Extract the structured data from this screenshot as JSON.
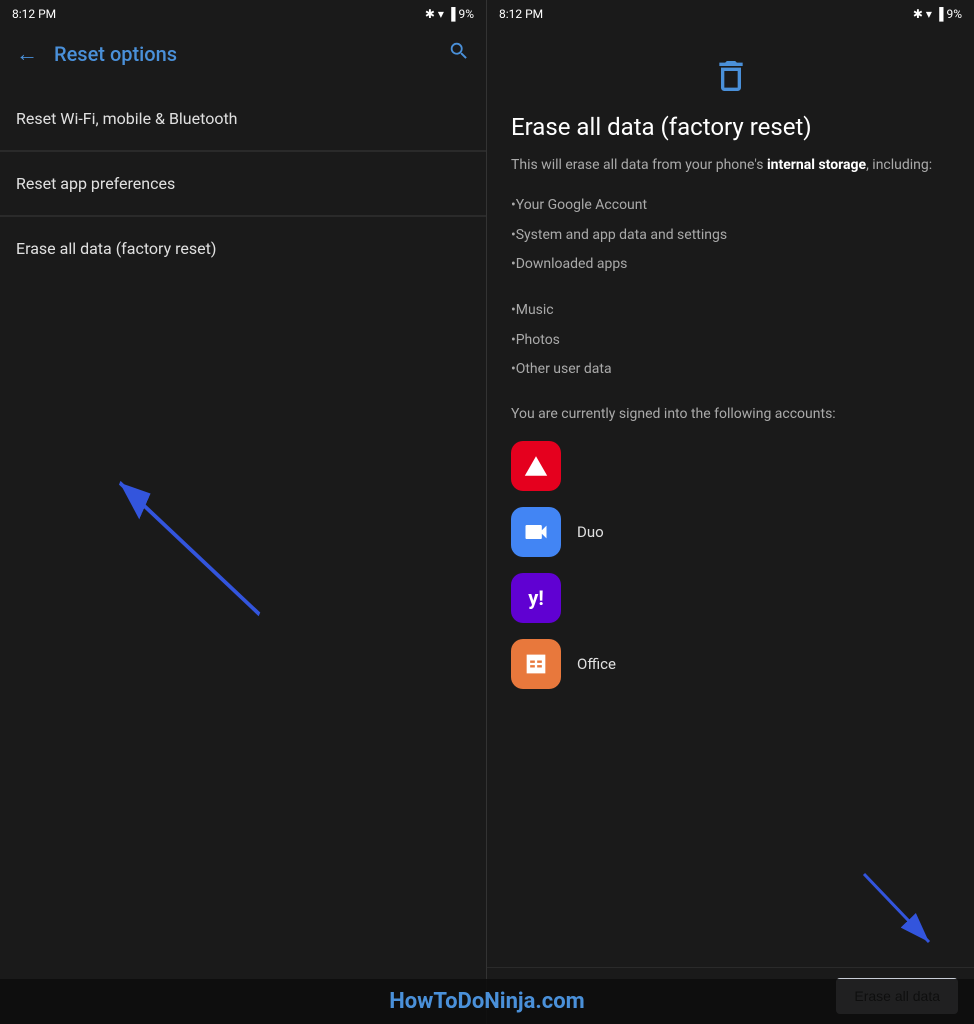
{
  "leftPanel": {
    "statusBar": {
      "time": "8:12 PM",
      "battery": "9%"
    },
    "toolbar": {
      "backIcon": "←",
      "title": "Reset options",
      "searchIcon": "🔍"
    },
    "menuItems": [
      {
        "label": "Reset Wi-Fi, mobile & Bluetooth"
      },
      {
        "label": "Reset app preferences"
      },
      {
        "label": "Erase all data (factory reset)"
      }
    ]
  },
  "rightPanel": {
    "statusBar": {
      "time": "8:12 PM",
      "battery": "9%"
    },
    "trashIcon": "🗑",
    "title": "Erase all data (factory reset)",
    "description_before": "This will erase all data from your phone's ",
    "description_bold": "internal storage",
    "description_after": ", including:",
    "dataItems": [
      "•Your Google Account",
      "•System and app data and settings",
      "•Downloaded apps",
      "•Music",
      "•Photos",
      "•Other user data"
    ],
    "accountsText": "You are currently signed into the following accounts:",
    "accounts": [
      {
        "name": "Adobe",
        "label": "",
        "iconType": "adobe"
      },
      {
        "name": "Duo",
        "label": "Duo",
        "iconType": "duo"
      },
      {
        "name": "Yahoo",
        "label": "",
        "iconType": "yahoo"
      },
      {
        "name": "Office",
        "label": "Office",
        "iconType": "office"
      }
    ],
    "eraseButton": "Erase all data"
  },
  "watermark": "HowToDoNinja.com"
}
